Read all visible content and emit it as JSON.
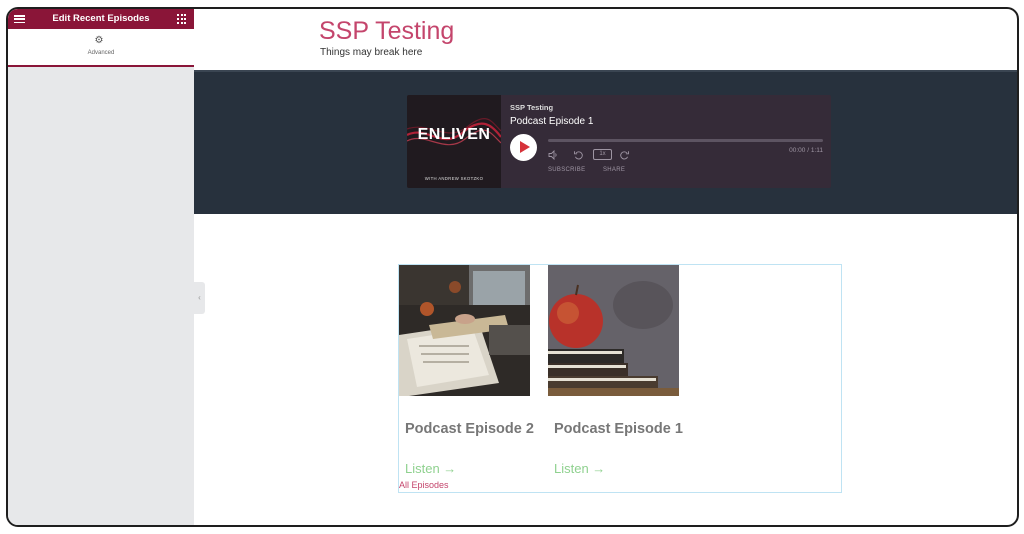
{
  "panel": {
    "title": "Edit Recent Episodes",
    "tab_label": "Advanced",
    "icons": {
      "menu": "hamburger-icon",
      "widgets": "grid-icon",
      "tab": "gear-icon",
      "collapse": "chevron-left-icon"
    }
  },
  "site": {
    "title": "SSP Testing",
    "tagline": "Things may break here"
  },
  "player": {
    "cover_brand": "ENLIVEN",
    "cover_byline": "WITH ANDREW SKOTZKO",
    "show": "SSP Testing",
    "episode": "Podcast Episode 1",
    "rate": "1x",
    "time": "00:00 / 1:11",
    "subscribe": "SUBSCRIBE",
    "share": "SHARE",
    "accent": "#d6323a"
  },
  "episodes": [
    {
      "title": "Podcast Episode 2",
      "listen": "Listen →"
    },
    {
      "title": "Podcast Episode 1",
      "listen": "Listen →"
    }
  ],
  "all_episodes": "All Episodes",
  "colors": {
    "brand": "#8a1538",
    "title": "#c4456c",
    "hero": "#27313d",
    "listen": "#8fd18f"
  }
}
